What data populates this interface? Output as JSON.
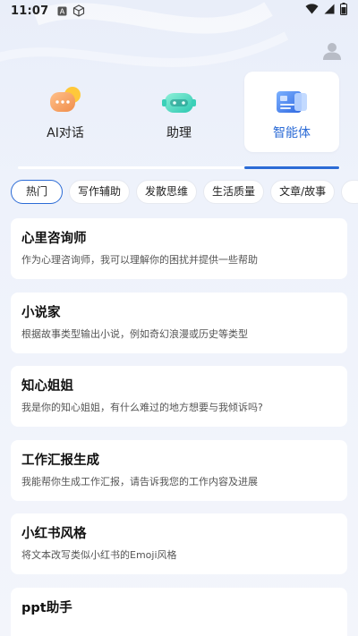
{
  "status_bar": {
    "time": "11:07",
    "icons": [
      "text-a-icon",
      "cube-icon",
      "wifi-icon",
      "signal-icon",
      "battery-icon"
    ]
  },
  "header": {
    "avatar_icon": "user-avatar-icon"
  },
  "mode_tabs": [
    {
      "label": "AI对话",
      "icon": "chat-bubble-icon",
      "active": false
    },
    {
      "label": "助理",
      "icon": "robot-icon",
      "active": false
    },
    {
      "label": "智能体",
      "icon": "agent-cards-icon",
      "active": true
    }
  ],
  "categories": [
    "热门",
    "写作辅助",
    "发散思维",
    "生活质量",
    "文章/故事",
    ""
  ],
  "active_category": "热门",
  "agents": [
    {
      "title": "心里咨询师",
      "description": "作为心理咨询师，我可以理解你的困扰并提供一些帮助"
    },
    {
      "title": "小说家",
      "description": "根据故事类型输出小说，例如奇幻浪漫或历史等类型"
    },
    {
      "title": "知心姐姐",
      "description": "我是你的知心姐姐，有什么难过的地方想要与我倾诉吗?"
    },
    {
      "title": "工作汇报生成",
      "description": "我能帮你生成工作汇报，请告诉我您的工作内容及进展"
    },
    {
      "title": "小红书风格",
      "description": "将文本改写类似小红书的Emoji风格"
    },
    {
      "title": "ppt助手",
      "description": ""
    }
  ],
  "colors": {
    "accent": "#2b6bd6",
    "card_bg": "#ffffff",
    "page_bg": "#eef2fb"
  }
}
